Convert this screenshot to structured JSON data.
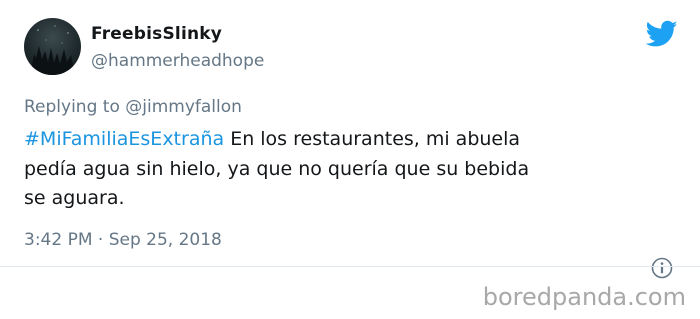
{
  "tweet": {
    "display_name": "FreebisSlinky",
    "handle": "@hammerheadhope",
    "reply_prefix": "Replying to ",
    "reply_mention": "@jimmyfallon",
    "hashtag": "#MiFamiliaEsExtraña",
    "text_line1": " En los restaurantes, mi abuela",
    "text_line2": "pedía agua sin hielo, ya que no quería que su bebida",
    "text_line3": "se aguara.",
    "timestamp": "3:42 PM · Sep 25, 2018"
  },
  "icons": {
    "brand": "twitter-bird-icon",
    "info": "info-icon"
  },
  "colors": {
    "brand": "#1da1f2",
    "hashtag": "#1b95e0",
    "secondary_text": "#657786"
  },
  "watermark": {
    "text": "boredpanda.com"
  }
}
